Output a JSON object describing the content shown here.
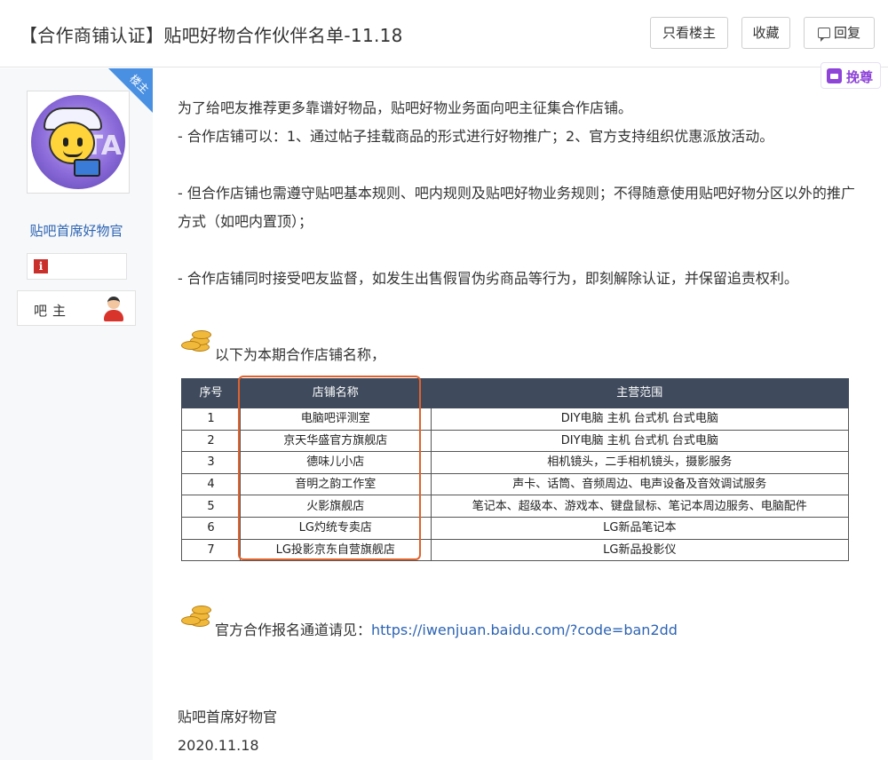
{
  "header": {
    "title": "【合作商铺认证】贴吧好物合作伙伴名单-11.18",
    "buttons": {
      "only_op": "只看楼主",
      "favorite": "收藏",
      "reply": "回复"
    }
  },
  "praise_label": "挽尊",
  "author": {
    "corner_badge": "楼主",
    "username": "贴吧首席好物官",
    "info_icon_glyph": "i",
    "role": "吧主",
    "avatar_text": "TA"
  },
  "post": {
    "paragraphs": [
      "为了给吧友推荐更多靠谱好物品，贴吧好物业务面向吧主征集合作店铺。",
      "- 合作店铺可以：1、通过帖子挂载商品的形式进行好物推广；2、官方支持组织优惠派放活动。",
      "- 但合作店铺也需遵守贴吧基本规则、吧内规则及贴吧好物业务规则；不得随意使用贴吧好物分区以外的推广方式（如吧内置顶）；",
      "- 合作店铺同时接受吧友监督，如发生出售假冒伪劣商品等行为，即刻解除认证，并保留追责权利。"
    ],
    "table_intro": "以下为本期合作店铺名称，",
    "signup_prefix": "官方合作报名通道请见：",
    "signup_link": "https://iwenjuan.baidu.com/?code=ban2dd",
    "signature": "贴吧首席好物官",
    "date": "2020.11.18"
  },
  "shop_table": {
    "headers": [
      "序号",
      "店铺名称",
      "主营范围"
    ],
    "rows": [
      [
        "1",
        "电脑吧评测室",
        "DIY电脑 主机 台式机 台式电脑"
      ],
      [
        "2",
        "京天华盛官方旗舰店",
        "DIY电脑 主机 台式机 台式电脑"
      ],
      [
        "3",
        "德味儿小店",
        "相机镜头，二手相机镜头，摄影服务"
      ],
      [
        "4",
        "音明之韵工作室",
        "声卡、话筒、音频周边、电声设备及音效调试服务"
      ],
      [
        "5",
        "火影旗舰店",
        "笔记本、超级本、游戏本、键盘鼠标、笔记本周边服务、电脑配件"
      ],
      [
        "6",
        "LG灼统专卖店",
        "LG新品笔记本"
      ],
      [
        "7",
        "LG投影京东自营旗舰店",
        "LG新品投影仪"
      ]
    ]
  },
  "colors": {
    "accent_link": "#2d64b3",
    "table_header": "#3f4a5c",
    "highlight_border": "#e0622d",
    "badge_blue": "#4a90e2"
  }
}
